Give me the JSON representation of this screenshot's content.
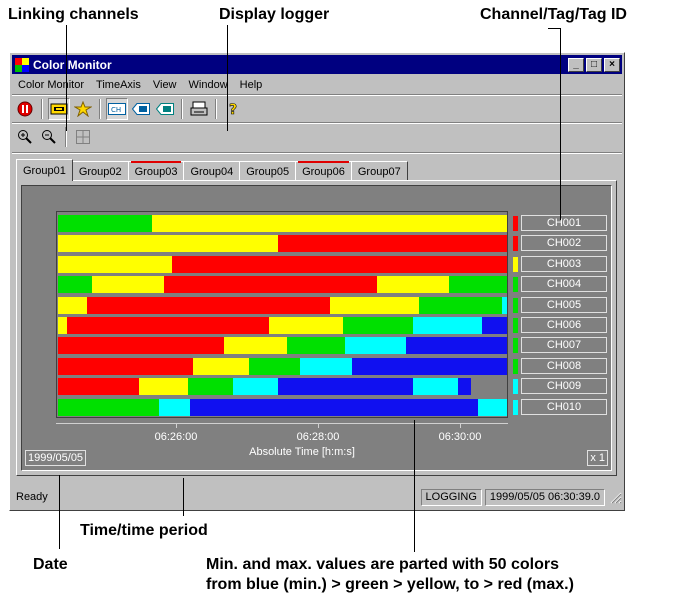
{
  "callouts": {
    "linking": "Linking channels",
    "display_logger": "Display logger",
    "channel_tag": "Channel/Tag/Tag ID",
    "time_period": "Time/time period",
    "date": "Date",
    "minmax_line1": "Min. and max.  values are parted with 50 colors",
    "minmax_line2": "from blue (min.) > green > yellow, to > red (max.)"
  },
  "window": {
    "title": "Color Monitor",
    "buttons": [
      "_",
      "□",
      "×"
    ]
  },
  "menu": [
    "Color Monitor",
    "TimeAxis",
    "View",
    "Window",
    "Help"
  ],
  "toolbar_icons": [
    "stop-icon",
    "link-icon",
    "star-icon",
    "ch-icon",
    "tag-icon",
    "tagid-icon",
    "logger-icon",
    "help-icon"
  ],
  "toolbar2_icons": [
    "zoom-in-icon",
    "zoom-out-icon",
    "grid-icon"
  ],
  "tabs": [
    {
      "label": "Group01",
      "active": true,
      "alarm": false
    },
    {
      "label": "Group02",
      "active": false,
      "alarm": false
    },
    {
      "label": "Group03",
      "active": false,
      "alarm": true
    },
    {
      "label": "Group04",
      "active": false,
      "alarm": false
    },
    {
      "label": "Group05",
      "active": false,
      "alarm": false
    },
    {
      "label": "Group06",
      "active": false,
      "alarm": true
    },
    {
      "label": "Group07",
      "active": false,
      "alarm": false
    }
  ],
  "colors": {
    "blue": "#1010f0",
    "cyan": "#00ffff",
    "green": "#00e000",
    "yellow": "#ffff00",
    "red": "#ff0000"
  },
  "channels": [
    {
      "label": "CH001",
      "current": "red",
      "segments": [
        [
          "green",
          0.21
        ],
        [
          "yellow",
          0.79
        ]
      ]
    },
    {
      "label": "CH002",
      "current": "red",
      "segments": [
        [
          "yellow",
          0.49
        ],
        [
          "red",
          0.51
        ]
      ]
    },
    {
      "label": "CH003",
      "current": "yellow",
      "segments": [
        [
          "yellow",
          0.255
        ],
        [
          "red",
          0.745
        ]
      ]
    },
    {
      "label": "CH004",
      "current": "green",
      "segments": [
        [
          "green",
          0.075
        ],
        [
          "yellow",
          0.16
        ],
        [
          "red",
          0.475
        ],
        [
          "yellow",
          0.16
        ],
        [
          "green",
          0.13
        ]
      ]
    },
    {
      "label": "CH005",
      "current": "green",
      "segments": [
        [
          "yellow",
          0.065
        ],
        [
          "red",
          0.54
        ],
        [
          "yellow",
          0.2
        ],
        [
          "green",
          0.185
        ],
        [
          "cyan",
          0.01
        ]
      ]
    },
    {
      "label": "CH006",
      "current": "green",
      "segments": [
        [
          "yellow",
          0.02
        ],
        [
          "red",
          0.45
        ],
        [
          "yellow",
          0.165
        ],
        [
          "green",
          0.155
        ],
        [
          "cyan",
          0.155
        ],
        [
          "blue",
          0.055
        ]
      ]
    },
    {
      "label": "CH007",
      "current": "green",
      "segments": [
        [
          "red",
          0.37
        ],
        [
          "yellow",
          0.14
        ],
        [
          "green",
          0.13
        ],
        [
          "cyan",
          0.135
        ],
        [
          "blue",
          0.225
        ]
      ]
    },
    {
      "label": "CH008",
      "current": "green",
      "segments": [
        [
          "red",
          0.3
        ],
        [
          "yellow",
          0.125
        ],
        [
          "green",
          0.115
        ],
        [
          "cyan",
          0.115
        ],
        [
          "blue",
          0.345
        ]
      ]
    },
    {
      "label": "CH009",
      "current": "cyan",
      "segments": [
        [
          "red",
          0.18
        ],
        [
          "yellow",
          0.11
        ],
        [
          "green",
          0.1
        ],
        [
          "cyan",
          0.1
        ],
        [
          "blue",
          0.3
        ],
        [
          "cyan",
          0.1
        ],
        [
          "blue",
          0.03
        ]
      ]
    },
    {
      "label": "CH010",
      "current": "cyan",
      "segments": [
        [
          "green",
          0.225
        ],
        [
          "cyan",
          0.07
        ],
        [
          "blue",
          0.64
        ],
        [
          "cyan",
          0.065
        ]
      ]
    }
  ],
  "time_axis": {
    "ticks": [
      "06:26:00",
      "06:28:00",
      "06:30:00"
    ],
    "title": "Absolute Time [h:m:s]",
    "date": "1999/05/05",
    "zoom": "x 1"
  },
  "status": {
    "ready": "Ready",
    "logging": "LOGGING",
    "timestamp": "1999/05/05 06:30:39.0"
  }
}
